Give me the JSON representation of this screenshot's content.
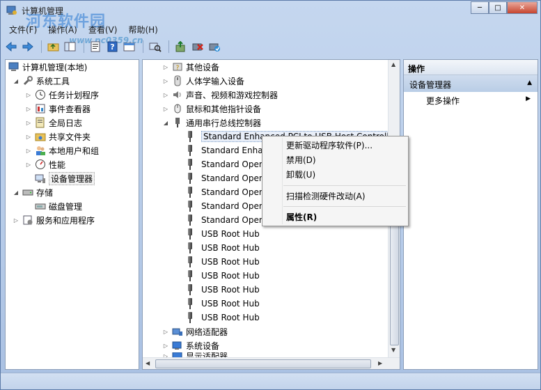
{
  "window": {
    "title": "计算机管理",
    "watermark": "河东软件园",
    "watermark_url": "www.pc0359.cn",
    "controls": {
      "minimize": "─",
      "maximize": "□",
      "close": "✕"
    }
  },
  "menu": [
    {
      "label": "文件(F)"
    },
    {
      "label": "操作(A)"
    },
    {
      "label": "查看(V)"
    },
    {
      "label": "帮助(H)"
    }
  ],
  "tree": {
    "root": "计算机管理(本地)",
    "system_tools": "系统工具",
    "items": [
      {
        "label": "任务计划程序"
      },
      {
        "label": "事件查看器"
      },
      {
        "label": "全局日志"
      },
      {
        "label": "共享文件夹"
      },
      {
        "label": "本地用户和组"
      },
      {
        "label": "性能"
      },
      {
        "label": "设备管理器"
      }
    ],
    "storage": "存储",
    "disk_mgmt": "磁盘管理",
    "services": "服务和应用程序"
  },
  "devices": {
    "categories_top": [
      {
        "label": "其他设备"
      },
      {
        "label": "人体学输入设备"
      },
      {
        "label": "声音、视频和游戏控制器"
      },
      {
        "label": "鼠标和其他指针设备"
      },
      {
        "label": "通用串行总线控制器"
      }
    ],
    "usb_children": [
      {
        "label": "Standard Enhanced PCI to USB Host Controller"
      },
      {
        "label": "Standard Enhan"
      },
      {
        "label": "Standard OpenH"
      },
      {
        "label": "Standard OpenH"
      },
      {
        "label": "Standard OpenH"
      },
      {
        "label": "Standard OpenH"
      },
      {
        "label": "Standard OpenH"
      },
      {
        "label": "USB Root Hub"
      },
      {
        "label": "USB Root Hub"
      },
      {
        "label": "USB Root Hub"
      },
      {
        "label": "USB Root Hub"
      },
      {
        "label": "USB Root Hub"
      },
      {
        "label": "USB Root Hub"
      },
      {
        "label": "USB Root Hub"
      }
    ],
    "categories_bottom": [
      {
        "label": "网络适配器"
      },
      {
        "label": "系统设备"
      },
      {
        "label": "显示适配器"
      }
    ]
  },
  "context_menu": {
    "update_driver": "更新驱动程序软件(P)...",
    "disable": "禁用(D)",
    "uninstall": "卸载(U)",
    "scan": "扫描检测硬件改动(A)",
    "properties": "属性(R)"
  },
  "actions": {
    "header": "操作",
    "section": "设备管理器",
    "more": "更多操作"
  }
}
